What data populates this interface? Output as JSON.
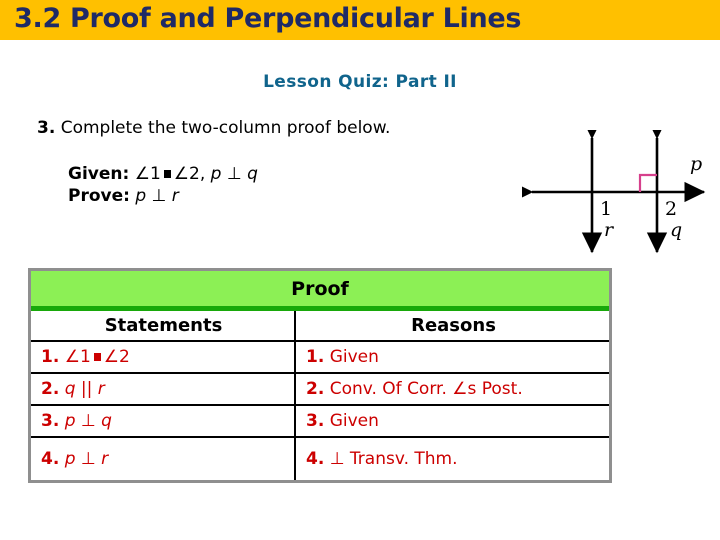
{
  "title_bar": {
    "title": "3.2 Proof and Perpendicular Lines",
    "background_color": "#FFC000",
    "text_color": "#1F2A66"
  },
  "quiz": {
    "heading": "Lesson Quiz: Part II",
    "heading_color": "#10648C"
  },
  "question": {
    "number": "3.",
    "text": "Complete the two-column proof below."
  },
  "given_prove": {
    "given_label": "Given:",
    "given_angle1": "∠1",
    "given_angle2": "∠2",
    "given_tail": ", ",
    "given_p": "p",
    "given_perp": "⊥",
    "given_q": "q",
    "prove_label": "Prove:",
    "prove_p": "p",
    "prove_perp": "⊥",
    "prove_r": "r"
  },
  "figure": {
    "label_p": "p",
    "label_q": "q",
    "label_r": "r",
    "label_1": "1",
    "label_2": "2",
    "right_angle_marker_color": "#D6408C",
    "line_color": "#000000"
  },
  "proof_table": {
    "header": "Proof",
    "header_bg": "#8CF055",
    "header_divider": "#18A80A",
    "border_color": "#8F8F8F",
    "text_color": "#CC0000",
    "columns": {
      "statements": "Statements",
      "reasons": "Reasons"
    },
    "rows": [
      {
        "num": "1.",
        "statement_angle1": "∠1",
        "statement_angle2": "∠2",
        "reason_num": "1.",
        "reason": "Given"
      },
      {
        "num": "2.",
        "statement_q": "q",
        "statement_par": "||",
        "statement_r": "r",
        "reason_num": "2.",
        "reason": "Conv. Of Corr. ∠s Post."
      },
      {
        "num": "3.",
        "statement_p": "p",
        "statement_perp": "⊥",
        "statement_q2": "q",
        "reason_num": "3.",
        "reason": "Given"
      },
      {
        "num": "4.",
        "statement_p": "p",
        "statement_perp": "⊥",
        "statement_r2": "r",
        "reason_num": "4.",
        "reason_perp": "⊥",
        "reason": "Transv. Thm."
      }
    ]
  }
}
